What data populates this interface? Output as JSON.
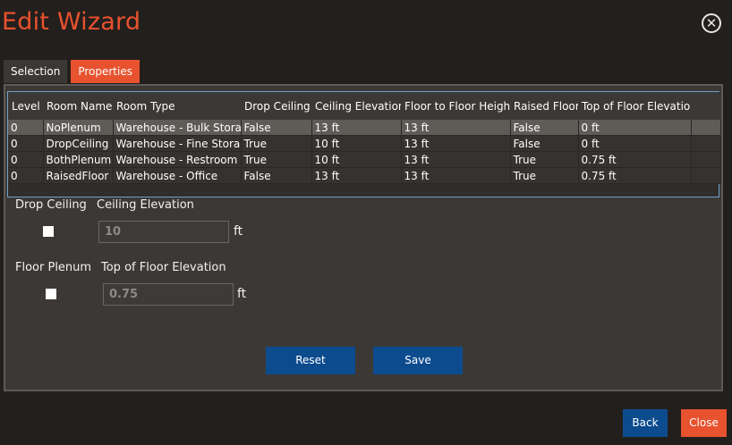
{
  "window": {
    "title": "Edit Wizard",
    "close_glyph": "✕"
  },
  "tabs": [
    {
      "label": "Selection"
    },
    {
      "label": "Properties"
    }
  ],
  "grid": {
    "columns": [
      "Level",
      "Room Name",
      "Room Type",
      "Drop Ceiling",
      "Ceiling Elevation",
      "Floor to Floor Height",
      "Raised Floor",
      "Top of Floor Elevation"
    ],
    "rows": [
      [
        "0",
        "NoPlenum",
        "Warehouse - Bulk Storage",
        "False",
        "13 ft",
        "13 ft",
        "False",
        "0 ft"
      ],
      [
        "0",
        "DropCeiling",
        "Warehouse - Fine Storage",
        "True",
        "10 ft",
        "13 ft",
        "False",
        "0 ft"
      ],
      [
        "0",
        "BothPlenum",
        "Warehouse - Restroom",
        "True",
        "10 ft",
        "13 ft",
        "True",
        "0.75 ft"
      ],
      [
        "0",
        "RaisedFloor",
        "Warehouse - Office",
        "False",
        "13 ft",
        "13 ft",
        "True",
        "0.75 ft"
      ]
    ]
  },
  "form": {
    "drop_ceiling_label": "Drop Ceiling",
    "ceiling_elevation_label": "Ceiling Elevation",
    "ceiling_elevation_value": "10",
    "ceiling_unit": "ft",
    "floor_plenum_label": "Floor Plenum",
    "top_floor_elevation_label": "Top of Floor Elevation",
    "top_floor_elevation_value": "0.75",
    "floor_unit": "ft"
  },
  "buttons": {
    "reset": "Reset",
    "save": "Save",
    "back": "Back",
    "close": "Close"
  },
  "colors": {
    "accent": "#e8522e",
    "primary": "#0d4b8f",
    "background": "#231f1d"
  }
}
